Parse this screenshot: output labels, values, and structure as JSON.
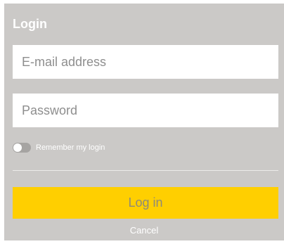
{
  "form": {
    "title": "Login",
    "email_placeholder": "E-mail address",
    "email_value": "",
    "password_placeholder": "Password",
    "password_value": "",
    "remember_label": "Remember my login",
    "remember_checked": false,
    "login_label": "Log in",
    "cancel_label": "Cancel"
  },
  "colors": {
    "panel_background": "#cbc9c7",
    "login_button": "#ffcf00",
    "login_button_text": "#8f8a78",
    "toggle_track": "#a6a4a2"
  }
}
